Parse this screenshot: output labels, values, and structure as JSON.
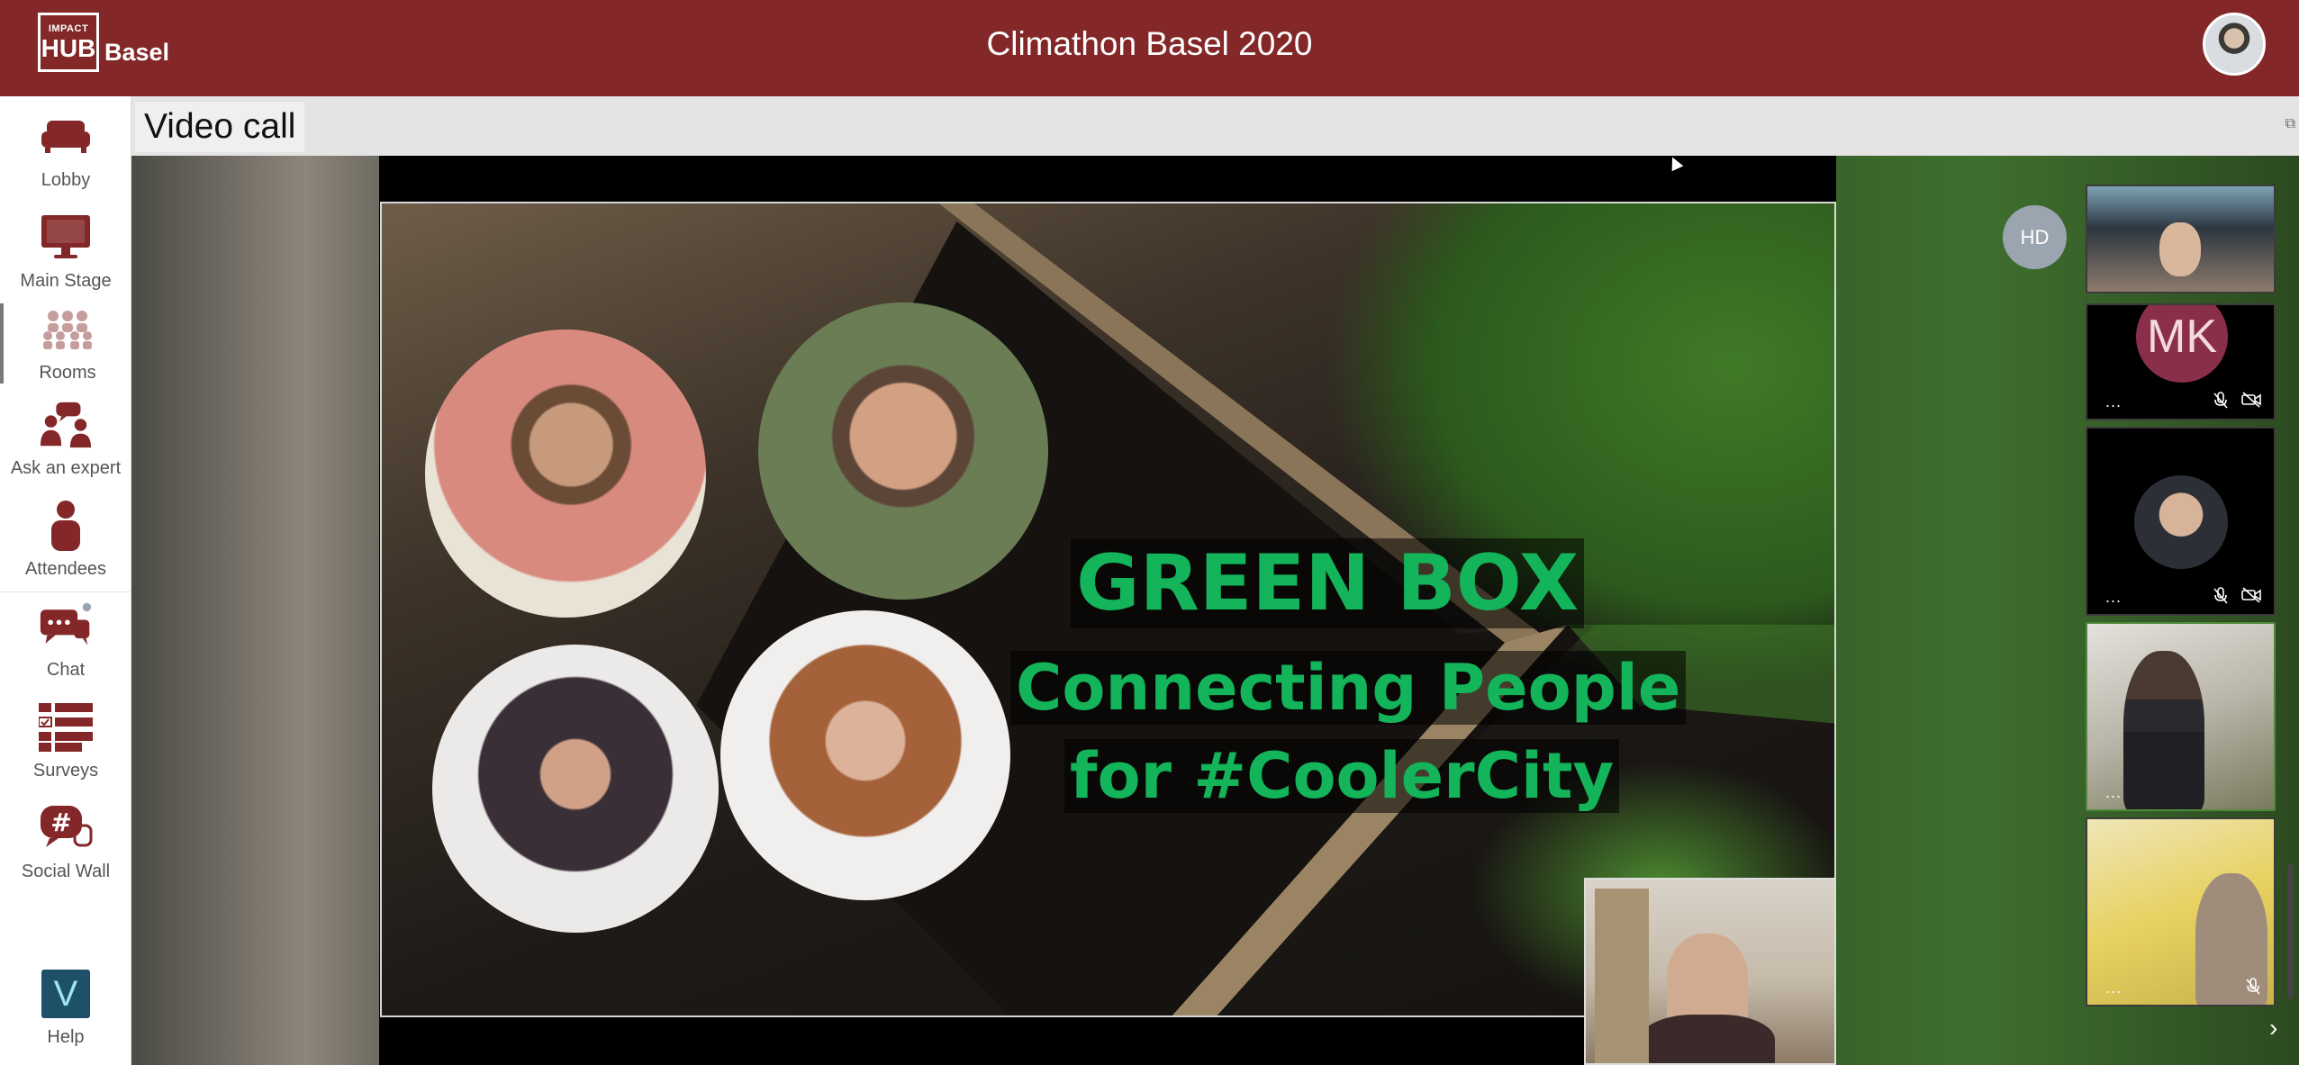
{
  "header": {
    "logo_small": "IMPACT",
    "logo_big": "HUB",
    "logo_city": "Basel",
    "title": "Climathon Basel 2020"
  },
  "sidebar": {
    "items": [
      {
        "label": "Lobby",
        "icon": "sofa-icon"
      },
      {
        "label": "Main Stage",
        "icon": "monitor-icon"
      },
      {
        "label": "Rooms",
        "icon": "people-group-icon"
      },
      {
        "label": "Ask an expert",
        "icon": "expert-chat-icon"
      },
      {
        "label": "Attendees",
        "icon": "person-icon"
      },
      {
        "label": "Chat",
        "icon": "chat-bubbles-icon"
      },
      {
        "label": "Surveys",
        "icon": "checklist-icon"
      },
      {
        "label": "Social Wall",
        "icon": "hashtag-icon"
      },
      {
        "label": "Help",
        "icon": "v-logo-icon"
      }
    ],
    "active": "Rooms",
    "accent_color": "#832728"
  },
  "video": {
    "title": "Video call",
    "slide": {
      "line1": "GREEN BOX",
      "line2": "Connecting People",
      "line3": "for #CoolerCity"
    },
    "participants": {
      "hd_initials": "HD",
      "mk_initials": "MK",
      "more_label": "..."
    }
  },
  "colors": {
    "brand": "#832728",
    "slide_text": "#13b45a",
    "mk_avatar": "#8a2f49",
    "hd_avatar": "#9aa5af"
  }
}
